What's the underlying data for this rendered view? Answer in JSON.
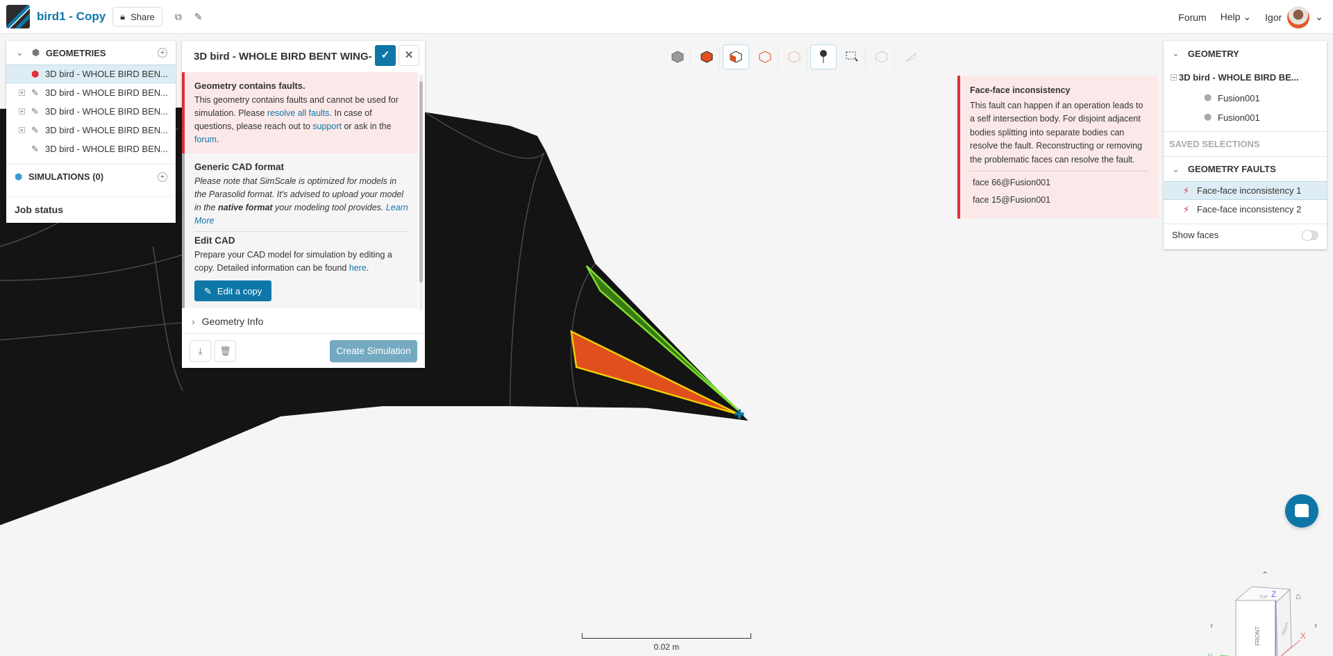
{
  "header": {
    "project_title": "bird1 - Copy",
    "share_label": "Share",
    "forum": "Forum",
    "help": "Help",
    "user": "Igor"
  },
  "left_panel": {
    "geometries_label": "GEOMETRIES",
    "geometry_items": [
      "3D bird - WHOLE BIRD BEN...",
      "3D bird - WHOLE BIRD BEN...",
      "3D bird - WHOLE BIRD BEN...",
      "3D bird - WHOLE BIRD BEN...",
      "3D bird - WHOLE BIRD BEN..."
    ],
    "simulations_label": "SIMULATIONS (0)",
    "job_status": "Job status"
  },
  "dialog": {
    "title": "3D bird - WHOLE BIRD BENT WING-",
    "alert_title": "Geometry contains faults.",
    "alert_t1": "This geometry contains faults and cannot be used for simulation. Please ",
    "alert_link1": "resolve all faults",
    "alert_t2": ". In case of questions, please reach out to ",
    "alert_link2": "support",
    "alert_t3": " or ask in the ",
    "alert_link3": "forum",
    "alert_t4": ".",
    "cad_title": "Generic CAD format",
    "cad_t1": "Please note that SimScale is optimized for models in the Parasolid format. It's advised to upload your model in the ",
    "cad_bold": "native format",
    "cad_t2": " your modeling tool provides. ",
    "cad_link": "Learn More",
    "edit_title": "Edit CAD",
    "edit_t1": "Prepare your CAD model for simulation by editing a copy. Detailed information can be found ",
    "edit_link": "here",
    "edit_t2": ".",
    "edit_button": "Edit a copy",
    "geometry_info": "Geometry Info",
    "create_simulation": "Create Simulation"
  },
  "fault_popup": {
    "title": "Face-face inconsistency",
    "body": "This fault can happen if an operation leads to a self intersection body. For disjoint adjacent bodies splitting into separate bodies can resolve the fault. Reconstructing or removing the problematic faces can resolve the fault.",
    "faces": [
      "face 66@Fusion001",
      "face 15@Fusion001"
    ]
  },
  "right_panel": {
    "geometry_label": "GEOMETRY",
    "geometry_name": "3D bird - WHOLE BIRD BE...",
    "bodies": [
      "Fusion001",
      "Fusion001"
    ],
    "saved_selections": "SAVED SELECTIONS",
    "faults_label": "GEOMETRY FAULTS",
    "faults": [
      "Face-face inconsistency 1",
      "Face-face inconsistency 2"
    ],
    "show_faces": "Show faces",
    "show_faces_on": false
  },
  "viewer": {
    "scale_label": "0.02 m",
    "cube_front": "FRONT",
    "cube_right": "RIGHT",
    "cube_top": "TOP",
    "axis_x": "X",
    "axis_y": "y",
    "axis_z": "Z",
    "colors": {
      "accent": "#0f77a8",
      "fault": "#e0303a",
      "orange_face": "#e0501c",
      "green_face": "#5fbf1f"
    }
  }
}
